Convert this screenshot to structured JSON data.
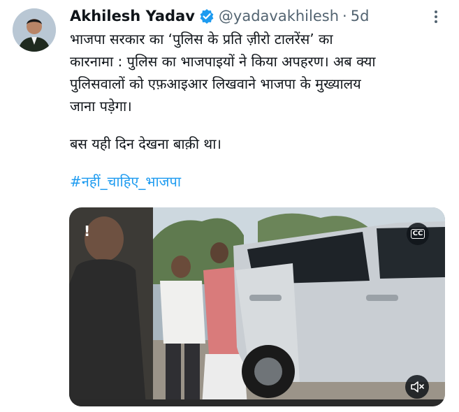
{
  "author": {
    "name": "Akhilesh Yadav",
    "handle": "@yadavakhilesh",
    "separator": "·",
    "time": "5d"
  },
  "tweet": {
    "lines": [
      "भाजपा सरकार का ‘पुलिस के प्रति ज़ीरो टालरेंस’ का",
      "कारनामा : पुलिस का भाजपाइयों ने किया अपहरण। अब क्या",
      "पुलिसवालों को एफ़आइआर लिखवाने भाजपा के मुख्यालय",
      "जाना पड़ेगा।"
    ],
    "line2": "बस यही दिन देखना बाक़ी था।",
    "hashtag": "#नहीं_चाहिए_भाजपा"
  },
  "media": {
    "cc_label": "CC",
    "overlay_glyph": "!"
  },
  "icons": {
    "verified": "verified-badge-icon",
    "more": "more-options-icon",
    "cc": "closed-captions-icon",
    "mute": "muted-speaker-icon"
  },
  "colors": {
    "link": "#1d9bf0",
    "secondary_text": "#536471",
    "primary_text": "#0f1419"
  }
}
